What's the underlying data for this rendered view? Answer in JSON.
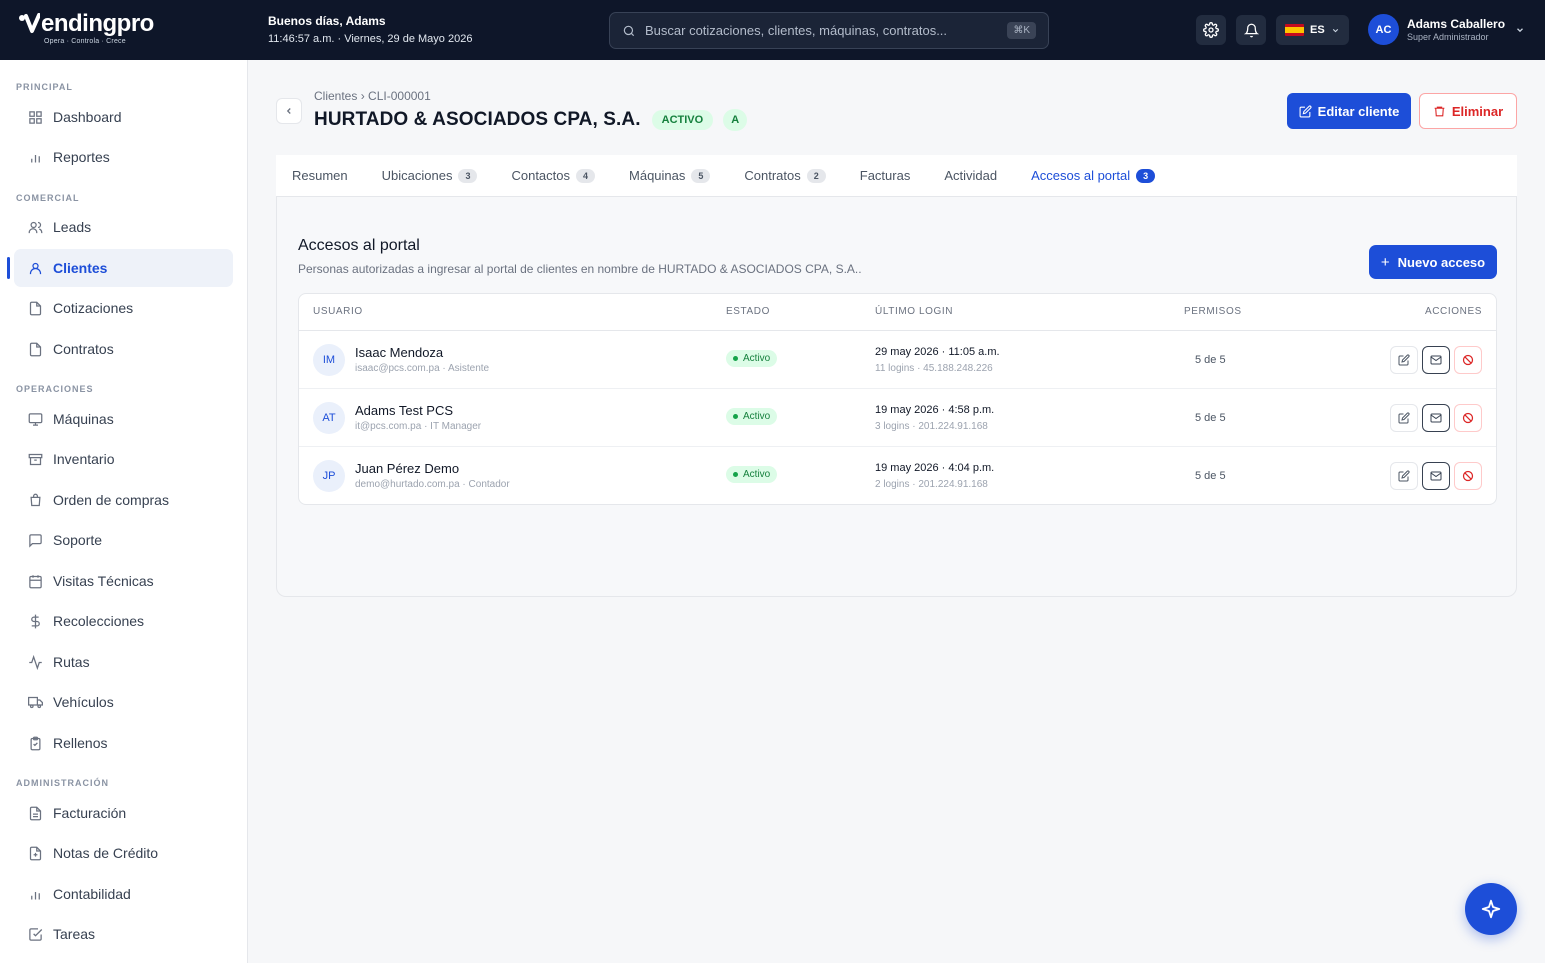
{
  "brand": {
    "name": "endingpro",
    "tagline": "Opera · Controla · Crece"
  },
  "topbar": {
    "greeting": "Buenos días, Adams",
    "datetime": "11:46:57 a.m. · Viernes, 29 de Mayo 2026",
    "search_placeholder": "Buscar cotizaciones, clientes, máquinas, contratos...",
    "search_shortcut": "⌘K",
    "language": "ES",
    "user_initials": "AC",
    "user_name": "Adams Caballero",
    "user_role": "Super Administrador"
  },
  "sidebar": {
    "sections": [
      {
        "label": "PRINCIPAL",
        "items": [
          {
            "label": "Dashboard",
            "icon": "grid-icon"
          },
          {
            "label": "Reportes",
            "icon": "bar-chart-icon"
          }
        ]
      },
      {
        "label": "COMERCIAL",
        "items": [
          {
            "label": "Leads",
            "icon": "users-icon"
          },
          {
            "label": "Clientes",
            "icon": "user-icon",
            "active": true
          },
          {
            "label": "Cotizaciones",
            "icon": "file-icon"
          },
          {
            "label": "Contratos",
            "icon": "file-icon"
          }
        ]
      },
      {
        "label": "OPERACIONES",
        "items": [
          {
            "label": "Máquinas",
            "icon": "monitor-icon"
          },
          {
            "label": "Inventario",
            "icon": "archive-icon"
          },
          {
            "label": "Orden de compras",
            "icon": "cart-icon"
          },
          {
            "label": "Soporte",
            "icon": "chat-icon"
          },
          {
            "label": "Visitas Técnicas",
            "icon": "calendar-icon"
          },
          {
            "label": "Recolecciones",
            "icon": "dollar-icon"
          },
          {
            "label": "Rutas",
            "icon": "activity-icon"
          },
          {
            "label": "Vehículos",
            "icon": "truck-icon"
          },
          {
            "label": "Rellenos",
            "icon": "clipboard-icon"
          }
        ]
      },
      {
        "label": "ADMINISTRACIÓN",
        "items": [
          {
            "label": "Facturación",
            "icon": "file-text-icon"
          },
          {
            "label": "Notas de Crédito",
            "icon": "file-plus-icon"
          },
          {
            "label": "Contabilidad",
            "icon": "bar-chart-icon"
          },
          {
            "label": "Tareas",
            "icon": "check-square-icon"
          }
        ]
      }
    ]
  },
  "header": {
    "breadcrumb_parent": "Clientes",
    "breadcrumb_sep": "›",
    "breadcrumb_current": "CLI-000001",
    "title": "HURTADO & ASOCIADOS CPA, S.A.",
    "status": "ACTIVO",
    "grade": "A",
    "edit_label": "Editar cliente",
    "delete_label": "Eliminar"
  },
  "tabs": [
    {
      "label": "Resumen"
    },
    {
      "label": "Ubicaciones",
      "count": "3"
    },
    {
      "label": "Contactos",
      "count": "4"
    },
    {
      "label": "Máquinas",
      "count": "5"
    },
    {
      "label": "Contratos",
      "count": "2"
    },
    {
      "label": "Facturas"
    },
    {
      "label": "Actividad"
    },
    {
      "label": "Accesos al portal",
      "count": "3",
      "active": true
    }
  ],
  "portal": {
    "title": "Accesos al portal",
    "subtitle": "Personas autorizadas a ingresar al portal de clientes en nombre de HURTADO & ASOCIADOS CPA, S.A..",
    "new_label": "Nuevo acceso",
    "columns": {
      "user": "USUARIO",
      "status": "ESTADO",
      "last_login": "ÚLTIMO LOGIN",
      "perms": "PERMISOS",
      "actions": "ACCIONES"
    },
    "rows": [
      {
        "initials": "IM",
        "name": "Isaac Mendoza",
        "meta": "isaac@pcs.com.pa · Asistente",
        "status": "Activo",
        "login": "29 may 2026 · 11:05 a.m.",
        "login_detail": "11 logins · 45.188.248.226",
        "perms": "5 de 5"
      },
      {
        "initials": "AT",
        "name": "Adams Test PCS",
        "meta": "it@pcs.com.pa · IT Manager",
        "status": "Activo",
        "login": "19 may 2026 · 4:58 p.m.",
        "login_detail": "3 logins · 201.224.91.168",
        "perms": "5 de 5"
      },
      {
        "initials": "JP",
        "name": "Juan Pérez Demo",
        "meta": "demo@hurtado.com.pa · Contador",
        "status": "Activo",
        "login": "19 may 2026 · 4:04 p.m.",
        "login_detail": "2 logins · 201.224.91.168",
        "perms": "5 de 5"
      }
    ]
  },
  "colors": {
    "primary": "#1d4ed8",
    "topbar": "#0e1629",
    "success": "#15803d",
    "danger": "#dc2626"
  }
}
